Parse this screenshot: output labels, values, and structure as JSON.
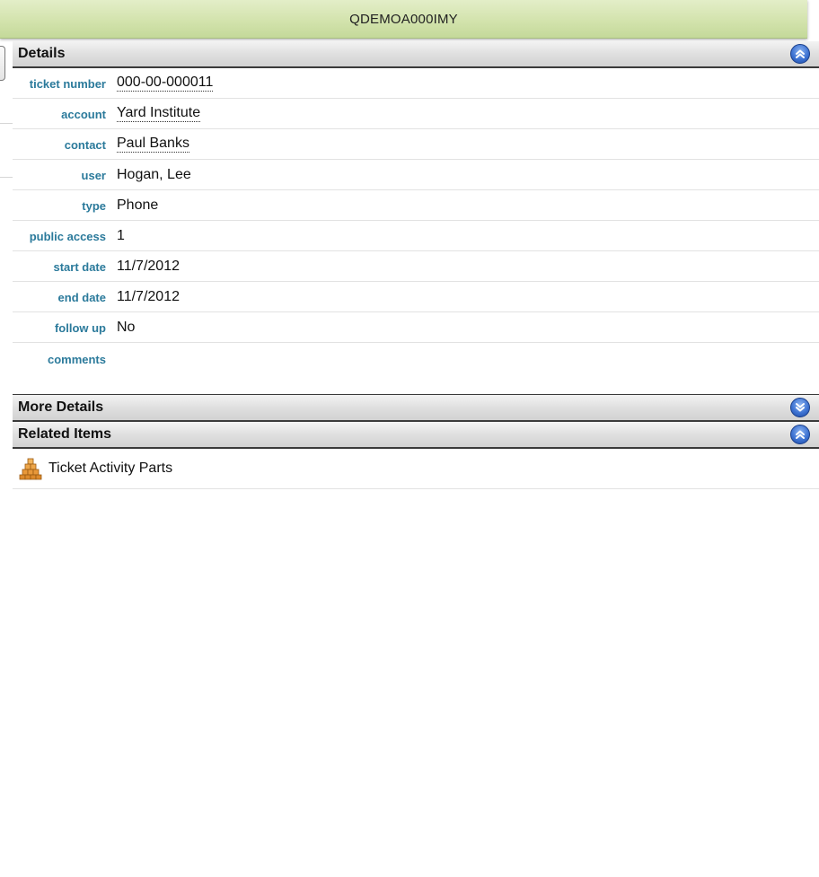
{
  "title": "QDEMOA000IMY",
  "sections": {
    "details": {
      "label": "Details",
      "toggle_icon": "collapse-up-icon",
      "fields": [
        {
          "label": "ticket number",
          "value": "000-00-000011",
          "link": true
        },
        {
          "label": "account",
          "value": "Yard Institute",
          "link": true
        },
        {
          "label": "contact",
          "value": "Paul Banks",
          "link": true
        },
        {
          "label": "user",
          "value": "Hogan, Lee",
          "link": false
        },
        {
          "label": "type",
          "value": "Phone",
          "link": false
        },
        {
          "label": "public access",
          "value": "1",
          "link": false
        },
        {
          "label": "start date",
          "value": "11/7/2012",
          "link": false
        },
        {
          "label": "end date",
          "value": "11/7/2012",
          "link": false
        },
        {
          "label": "follow up",
          "value": "No",
          "link": false
        },
        {
          "label": "comments",
          "value": "",
          "link": false
        }
      ]
    },
    "more_details": {
      "label": "More Details",
      "toggle_icon": "expand-down-icon"
    },
    "related_items": {
      "label": "Related Items",
      "toggle_icon": "collapse-up-icon",
      "items": [
        {
          "label": "Ticket Activity Parts",
          "icon": "boxes-stack-icon"
        }
      ]
    }
  },
  "colors": {
    "titlebar": "#d3e3ad",
    "label": "#2b7a9b",
    "toggle": "#3f74d3"
  }
}
